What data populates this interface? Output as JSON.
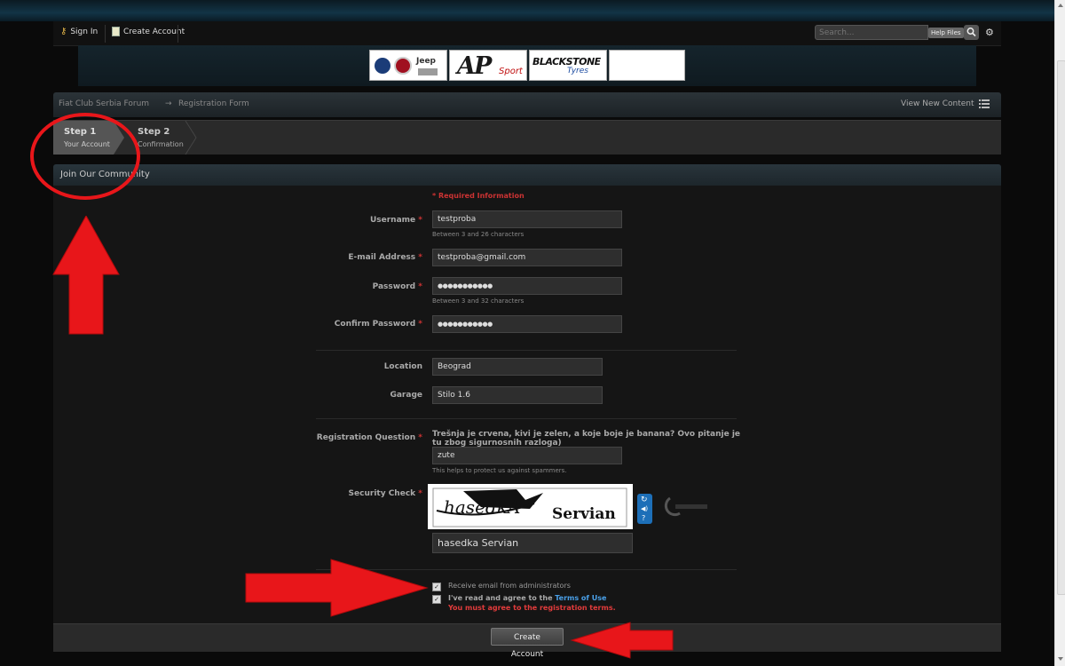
{
  "colors": {
    "annotation_red": "#e8161a",
    "required_red": "#cc3333",
    "link_blue": "#4aa0e8"
  },
  "topbar": {
    "sign_in": "Sign In",
    "sign_in_icon": "key-icon",
    "create_account": "Create Account",
    "create_account_icon": "document-icon",
    "search_placeholder": "Search...",
    "help_files": "Help Files",
    "search_icon": "search-icon",
    "settings_icon": "gear-icon"
  },
  "sponsors": {
    "brands": [
      "Jeep"
    ],
    "ap_logo": "AP",
    "ap_script": "Sport",
    "blackstone_top": "BLACKSTONE",
    "blackstone_bottom": "Tyres"
  },
  "breadcrumb": {
    "forum": "Fiat Club Serbia Forum",
    "arrow": "→",
    "current": "Registration Form",
    "view_new": "View New Content"
  },
  "steps": [
    {
      "title": "Step 1",
      "subtitle": "Your Account"
    },
    {
      "title": "Step 2",
      "subtitle": "Confirmation"
    }
  ],
  "panel": {
    "title": "Join Our Community"
  },
  "form": {
    "required_info": "* Required Information",
    "username": {
      "label": "Username",
      "value": "testproba",
      "hint": "Between 3 and 26 characters"
    },
    "email": {
      "label": "E-mail Address",
      "value": "testproba@gmail.com"
    },
    "password": {
      "label": "Password",
      "value": "●●●●●●●●●●●",
      "hint": "Between 3 and 32 characters"
    },
    "confirm_password": {
      "label": "Confirm Password",
      "value": "●●●●●●●●●●●"
    },
    "location": {
      "label": "Location",
      "value": "Beograd"
    },
    "garage": {
      "label": "Garage",
      "value": "Stilo 1.6"
    },
    "question": {
      "label": "Registration Question",
      "text": "Trešnja je crvena, kivi je zelen, a koje boje je banana? Ovo pitanje je tu zbog sigurnosnih razloga)",
      "value": "zute",
      "hint": "This helps to protect us against spammers."
    },
    "security": {
      "label": "Security Check",
      "captcha_word1": "hasedkA",
      "captcha_word2": "Servian",
      "value": "hasedka Servian",
      "refresh_icon": "refresh-icon",
      "audio_icon": "audio-icon",
      "help_icon": "help-icon"
    },
    "receive_email": "Receive email from administrators",
    "agree_prefix": "I've read and agree to the ",
    "terms_link": "Terms of Use",
    "agree_error": "You must agree to the registration terms.",
    "submit": "Create Account"
  }
}
